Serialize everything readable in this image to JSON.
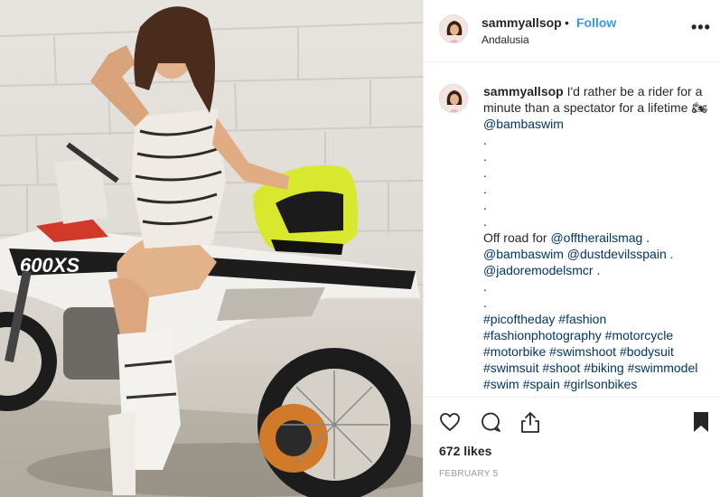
{
  "post": {
    "username": "sammyallsop",
    "follow_label": "Follow",
    "dot": "•",
    "location": "Andalusia",
    "more": "•••",
    "photo_kit_text": "600XS"
  },
  "caption": {
    "username": "sammyallsop",
    "text_1": " I'd rather be a rider for a minute than a spectator for a lifetime ",
    "emoji": "🏍",
    "mention_1": "@bambaswim",
    "dots": "\n.\n.\n.\n.\n.\n.\n",
    "line_off": "Off road for ",
    "mention_2": "@offtherailsmag",
    "sep_1": " .\n",
    "mention_3": "@bambaswim",
    "sp_1": " ",
    "mention_4": "@dustdevilsspain",
    "sep_2": " .\n",
    "mention_5": "@jadoremodelsmcr",
    "sep_3": " .\n.\n.\n",
    "hashtags": [
      "#picoftheday",
      "#fashion",
      "#fashionphotography",
      "#motorcycle",
      "#motorbike",
      "#swimshoot",
      "#bodysuit",
      "#swimsuit",
      "#shoot",
      "#biking",
      "#swimmodel",
      "#swim",
      "#spain",
      "#girlsonbikes"
    ]
  },
  "footer": {
    "likes": "672 likes",
    "date": "February 5"
  },
  "icons": {
    "like": "heart-icon",
    "comment": "comment-icon",
    "share": "share-icon",
    "save": "bookmark-icon",
    "more": "more-options-icon"
  }
}
